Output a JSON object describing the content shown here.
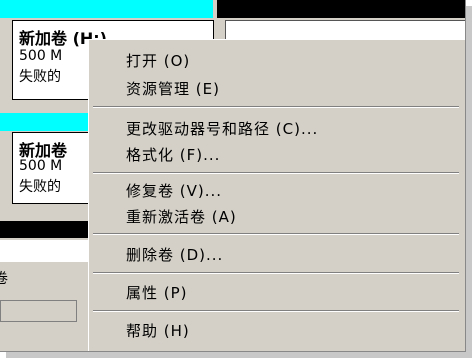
{
  "volumes": [
    {
      "title": "新加卷  (H:)",
      "size": "500 M",
      "status": "失败的"
    },
    {
      "title": "新加卷",
      "size": "500 M",
      "status": "失败的"
    }
  ],
  "left_edge_text": "卷",
  "context_menu": {
    "items": [
      {
        "label": "打开 (O)"
      },
      {
        "label": "资源管理 (E)"
      },
      {
        "label": "更改驱动器号和路径 (C)..."
      },
      {
        "label": "格式化 (F)..."
      },
      {
        "label": "修复卷 (V)..."
      },
      {
        "label": "重新激活卷 (A)"
      },
      {
        "label": "删除卷 (D)..."
      },
      {
        "label": "属性 (P)"
      },
      {
        "label": "帮助 (H)"
      }
    ]
  },
  "colors": {
    "volume_header": "#00ffff",
    "menu_bg": "#d4d0c8"
  }
}
